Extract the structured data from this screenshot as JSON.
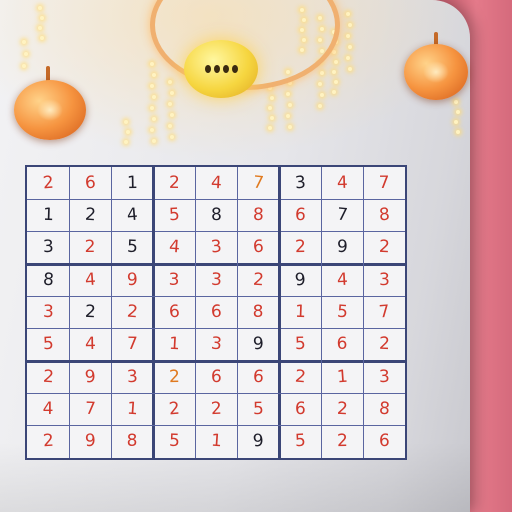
{
  "sudoku": {
    "rows": [
      [
        "2",
        "6",
        "1",
        "2",
        "4",
        "7",
        "3",
        "4",
        "7"
      ],
      [
        "1",
        "2",
        "4",
        "5",
        "8",
        "8",
        "6",
        "7",
        "8"
      ],
      [
        "3",
        "2",
        "5",
        "4",
        "3",
        "6",
        "2",
        "9",
        "2"
      ],
      [
        "8",
        "4",
        "9",
        "3",
        "3",
        "2",
        "9",
        "4",
        "3"
      ],
      [
        "3",
        "2",
        "2",
        "6",
        "6",
        "8",
        "1",
        "5",
        "7"
      ],
      [
        "5",
        "4",
        "7",
        "1",
        "3",
        "9",
        "5",
        "6",
        "2"
      ],
      [
        "2",
        "9",
        "3",
        "2",
        "6",
        "6",
        "2",
        "1",
        "3"
      ],
      [
        "4",
        "7",
        "1",
        "2",
        "2",
        "5",
        "6",
        "2",
        "8"
      ],
      [
        "2",
        "9",
        "8",
        "5",
        "1",
        "9",
        "5",
        "2",
        "6"
      ]
    ],
    "colors": [
      [
        "red",
        "red",
        "dark",
        "red",
        "red",
        "orange",
        "dark",
        "red",
        "red"
      ],
      [
        "dark",
        "dark",
        "dark",
        "red",
        "dark",
        "red",
        "red",
        "dark",
        "red"
      ],
      [
        "dark",
        "red",
        "dark",
        "red",
        "red",
        "red",
        "red",
        "dark",
        "red"
      ],
      [
        "dark",
        "red",
        "red",
        "red",
        "red",
        "red",
        "dark",
        "red",
        "red"
      ],
      [
        "red",
        "dark",
        "red",
        "red",
        "red",
        "red",
        "red",
        "red",
        "red"
      ],
      [
        "red",
        "red",
        "red",
        "red",
        "red",
        "dark",
        "red",
        "red",
        "red"
      ],
      [
        "red",
        "red",
        "red",
        "orange",
        "red",
        "red",
        "red",
        "red",
        "red"
      ],
      [
        "red",
        "red",
        "red",
        "red",
        "red",
        "red",
        "red",
        "red",
        "red"
      ],
      [
        "red",
        "red",
        "red",
        "red",
        "red",
        "dark",
        "red",
        "red",
        "red"
      ]
    ],
    "palette": {
      "red": "#d23a2e",
      "orange": "#e07a20",
      "dark": "#1e1e2a",
      "grid": "#3b4677"
    }
  },
  "ornaments": {
    "bulb_color": "#f6d640",
    "heart_color": "#f69440",
    "wall_color": "#e47a8a"
  }
}
